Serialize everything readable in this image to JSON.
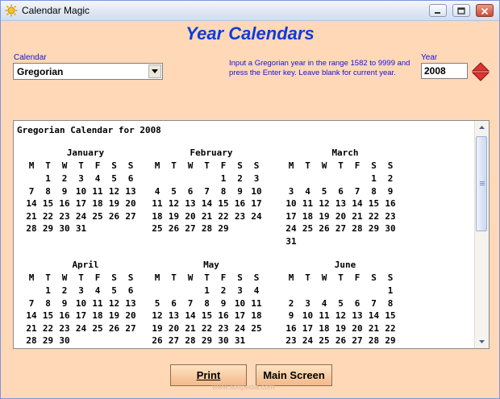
{
  "window": {
    "title": "Calendar Magic"
  },
  "heading": "Year Calendars",
  "calendar_select": {
    "label": "Calendar",
    "value": "Gregorian"
  },
  "hint": "Input a Gregorian year in the range 1582 to 9999 and press the Enter key. Leave blank for current year.",
  "year_input": {
    "label": "Year",
    "value": "2008"
  },
  "calendar_output": {
    "title": "Gregorian Calendar for 2008",
    "weekdays": [
      "M",
      "T",
      "W",
      "T",
      "F",
      "S",
      "S"
    ],
    "months": [
      {
        "name": "January",
        "weeks": [
          [
            "",
            "1",
            "2",
            "3",
            "4",
            "5",
            "6"
          ],
          [
            "7",
            "8",
            "9",
            "10",
            "11",
            "12",
            "13"
          ],
          [
            "14",
            "15",
            "16",
            "17",
            "18",
            "19",
            "20"
          ],
          [
            "21",
            "22",
            "23",
            "24",
            "25",
            "26",
            "27"
          ],
          [
            "28",
            "29",
            "30",
            "31",
            "",
            "",
            ""
          ]
        ]
      },
      {
        "name": "February",
        "weeks": [
          [
            "",
            "",
            "",
            "",
            "1",
            "2",
            "3"
          ],
          [
            "4",
            "5",
            "6",
            "7",
            "8",
            "9",
            "10"
          ],
          [
            "11",
            "12",
            "13",
            "14",
            "15",
            "16",
            "17"
          ],
          [
            "18",
            "19",
            "20",
            "21",
            "22",
            "23",
            "24"
          ],
          [
            "25",
            "26",
            "27",
            "28",
            "29",
            "",
            ""
          ]
        ]
      },
      {
        "name": "March",
        "weeks": [
          [
            "",
            "",
            "",
            "",
            "",
            "1",
            "2"
          ],
          [
            "3",
            "4",
            "5",
            "6",
            "7",
            "8",
            "9"
          ],
          [
            "10",
            "11",
            "12",
            "13",
            "14",
            "15",
            "16"
          ],
          [
            "17",
            "18",
            "19",
            "20",
            "21",
            "22",
            "23"
          ],
          [
            "24",
            "25",
            "26",
            "27",
            "28",
            "29",
            "30"
          ],
          [
            "31",
            "",
            "",
            "",
            "",
            "",
            ""
          ]
        ]
      },
      {
        "name": "April",
        "weeks": [
          [
            "",
            "1",
            "2",
            "3",
            "4",
            "5",
            "6"
          ],
          [
            "7",
            "8",
            "9",
            "10",
            "11",
            "12",
            "13"
          ],
          [
            "14",
            "15",
            "16",
            "17",
            "18",
            "19",
            "20"
          ],
          [
            "21",
            "22",
            "23",
            "24",
            "25",
            "26",
            "27"
          ],
          [
            "28",
            "29",
            "30",
            "",
            "",
            "",
            ""
          ]
        ]
      },
      {
        "name": "May",
        "weeks": [
          [
            "",
            "",
            "",
            "1",
            "2",
            "3",
            "4"
          ],
          [
            "5",
            "6",
            "7",
            "8",
            "9",
            "10",
            "11"
          ],
          [
            "12",
            "13",
            "14",
            "15",
            "16",
            "17",
            "18"
          ],
          [
            "19",
            "20",
            "21",
            "22",
            "23",
            "24",
            "25"
          ],
          [
            "26",
            "27",
            "28",
            "29",
            "30",
            "31",
            ""
          ]
        ]
      },
      {
        "name": "June",
        "weeks": [
          [
            "",
            "",
            "",
            "",
            "",
            "",
            "1"
          ],
          [
            "2",
            "3",
            "4",
            "5",
            "6",
            "7",
            "8"
          ],
          [
            "9",
            "10",
            "11",
            "12",
            "13",
            "14",
            "15"
          ],
          [
            "16",
            "17",
            "18",
            "19",
            "20",
            "21",
            "22"
          ],
          [
            "23",
            "24",
            "25",
            "26",
            "27",
            "28",
            "29"
          ]
        ]
      }
    ]
  },
  "buttons": {
    "print": "Print",
    "main_screen": "Main Screen"
  },
  "watermark": "www.softpedia.com",
  "colors": {
    "background": "#ffd8b8",
    "accent_text": "#1414d0",
    "heading": "#0d3dd6",
    "button": "#f2b98a"
  },
  "icons": {
    "app": "calendar-sun-icon",
    "spinner": "up-down-arrows-icon"
  }
}
